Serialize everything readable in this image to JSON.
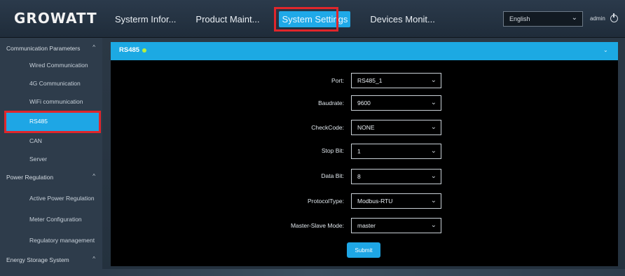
{
  "header": {
    "logo": "GROWATT",
    "nav": [
      "Systerm Infor...",
      "Product Maint...",
      "System Settings",
      "Devices Monit..."
    ],
    "language": "English",
    "user": "admin"
  },
  "sidebar": {
    "items": [
      {
        "label": "Communication Parameters",
        "type": "group"
      },
      {
        "label": "Wired Communication",
        "type": "sub"
      },
      {
        "label": "4G Communication",
        "type": "sub"
      },
      {
        "label": "WiFi communication",
        "type": "sub"
      },
      {
        "label": "RS485",
        "type": "sub",
        "active": true
      },
      {
        "label": "CAN",
        "type": "sub"
      },
      {
        "label": "Server",
        "type": "sub"
      },
      {
        "label": "Power Regulation",
        "type": "group"
      },
      {
        "label": "Active Power Regulation",
        "type": "sub"
      },
      {
        "label": "Meter Configuration",
        "type": "sub"
      },
      {
        "label": "Regulatory management",
        "type": "sub"
      },
      {
        "label": "Energy Storage System",
        "type": "group"
      }
    ]
  },
  "panel": {
    "title": "RS485",
    "fields": [
      {
        "label": "Port:",
        "value": "RS485_1"
      },
      {
        "label": "Baudrate:",
        "value": "9600"
      },
      {
        "label": "CheckCode:",
        "value": "NONE"
      },
      {
        "label": "Stop Bit:",
        "value": "1"
      },
      {
        "label": "Data Bit:",
        "value": "8"
      },
      {
        "label": "ProtocolType:",
        "value": "Modbus-RTU"
      },
      {
        "label": "Master-Slave Mode:",
        "value": "master"
      }
    ],
    "submit_label": "Submit"
  },
  "colors": {
    "accent": "#1ea6e5",
    "highlight": "#e0262b",
    "status_dot": "#b9ef3c"
  }
}
